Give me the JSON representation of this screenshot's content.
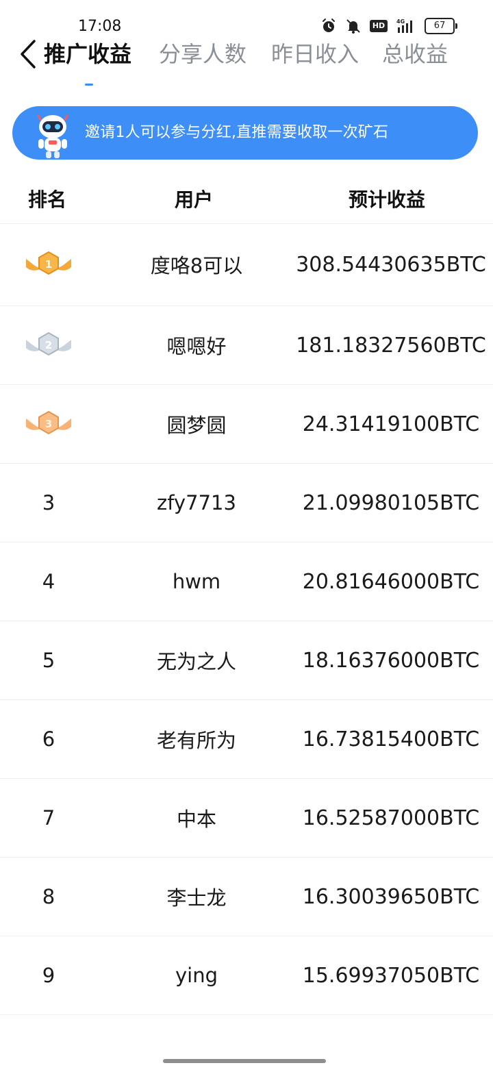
{
  "status_bar": {
    "time": "17:08",
    "network": "4G",
    "hd": "HD",
    "battery": "67"
  },
  "nav": {
    "tabs": [
      {
        "label": "推广收益",
        "active": true
      },
      {
        "label": "分享人数",
        "active": false
      },
      {
        "label": "昨日收入",
        "active": false
      },
      {
        "label": "总收益",
        "active": false
      }
    ]
  },
  "banner": {
    "text": "邀请1人可以参与分红,直推需要收取一次矿石",
    "color": "#3d8ef7"
  },
  "table": {
    "headers": {
      "rank": "排名",
      "user": "用户",
      "earnings": "预计收益"
    },
    "rows": [
      {
        "rank": "1",
        "medal": "gold",
        "user": "度咯8可以",
        "earnings": "308.54430635BTC"
      },
      {
        "rank": "2",
        "medal": "silver",
        "user": "嗯嗯好",
        "earnings": "181.18327560BTC"
      },
      {
        "rank": "3",
        "medal": "bronze",
        "user": "圆梦圆",
        "earnings": "24.31419100BTC"
      },
      {
        "rank": "3",
        "user": "zfy7713",
        "earnings": "21.09980105BTC"
      },
      {
        "rank": "4",
        "user": "hwm",
        "earnings": "20.81646000BTC"
      },
      {
        "rank": "5",
        "user": "无为之人",
        "earnings": "18.16376000BTC"
      },
      {
        "rank": "6",
        "user": "老有所为",
        "earnings": "16.73815400BTC"
      },
      {
        "rank": "7",
        "user": "中本",
        "earnings": "16.52587000BTC"
      },
      {
        "rank": "8",
        "user": "李士龙",
        "earnings": "16.30039650BTC"
      },
      {
        "rank": "9",
        "user": "ying",
        "earnings": "15.69937050BTC"
      }
    ]
  },
  "colors": {
    "accent": "#3b8cf5",
    "gold": "#f3a93a",
    "silver": "#c9d3dd",
    "bronze": "#f7b274"
  }
}
